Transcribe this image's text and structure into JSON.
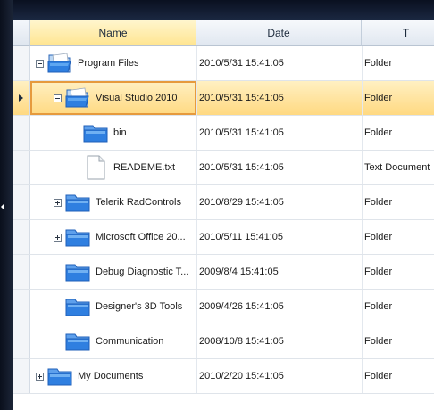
{
  "grid": {
    "columns": [
      {
        "key": "name",
        "label": "Name",
        "sorted": true
      },
      {
        "key": "date",
        "label": "Date",
        "sorted": false
      },
      {
        "key": "type",
        "label": "T",
        "sorted": false
      }
    ],
    "rows": [
      {
        "name": "Program Files",
        "date": "2010/5/31 15:41:05",
        "type": "Folder",
        "level": 0,
        "expander": "minus",
        "icon": "folder-open-icon",
        "selected": false
      },
      {
        "name": "Visual Studio 2010",
        "date": "2010/5/31 15:41:05",
        "type": "Folder",
        "level": 1,
        "expander": "minus",
        "icon": "folder-open-icon",
        "selected": true
      },
      {
        "name": "bin",
        "date": "2010/5/31 15:41:05",
        "type": "Folder",
        "level": 2,
        "expander": "none",
        "icon": "folder-icon",
        "selected": false
      },
      {
        "name": "READEME.txt",
        "date": "2010/5/31 15:41:05",
        "type": "Text Document",
        "level": 2,
        "expander": "none",
        "icon": "document-icon",
        "selected": false
      },
      {
        "name": "Telerik RadControls",
        "date": "2010/8/29 15:41:05",
        "type": "Folder",
        "level": 1,
        "expander": "plus",
        "icon": "folder-icon",
        "selected": false
      },
      {
        "name": "Microsoft Office 20...",
        "date": "2010/5/11 15:41:05",
        "type": "Folder",
        "level": 1,
        "expander": "plus",
        "icon": "folder-icon",
        "selected": false
      },
      {
        "name": "Debug Diagnostic T...",
        "date": "2009/8/4 15:41:05",
        "type": "Folder",
        "level": 1,
        "expander": "none",
        "icon": "folder-icon",
        "selected": false
      },
      {
        "name": "Designer's 3D Tools",
        "date": "2009/4/26 15:41:05",
        "type": "Folder",
        "level": 1,
        "expander": "none",
        "icon": "folder-icon",
        "selected": false
      },
      {
        "name": "Communication",
        "date": "2008/10/8 15:41:05",
        "type": "Folder",
        "level": 1,
        "expander": "none",
        "icon": "folder-icon",
        "selected": false
      },
      {
        "name": "My Documents",
        "date": "2010/2/20 15:41:05",
        "type": "Folder",
        "level": 0,
        "expander": "plus",
        "icon": "folder-icon",
        "selected": false
      }
    ]
  },
  "colors": {
    "header_sorted": "#ffe591",
    "selected_row": "#ffd981",
    "selected_border": "#e69a3d",
    "folder_blue": "#2f7fe0"
  }
}
